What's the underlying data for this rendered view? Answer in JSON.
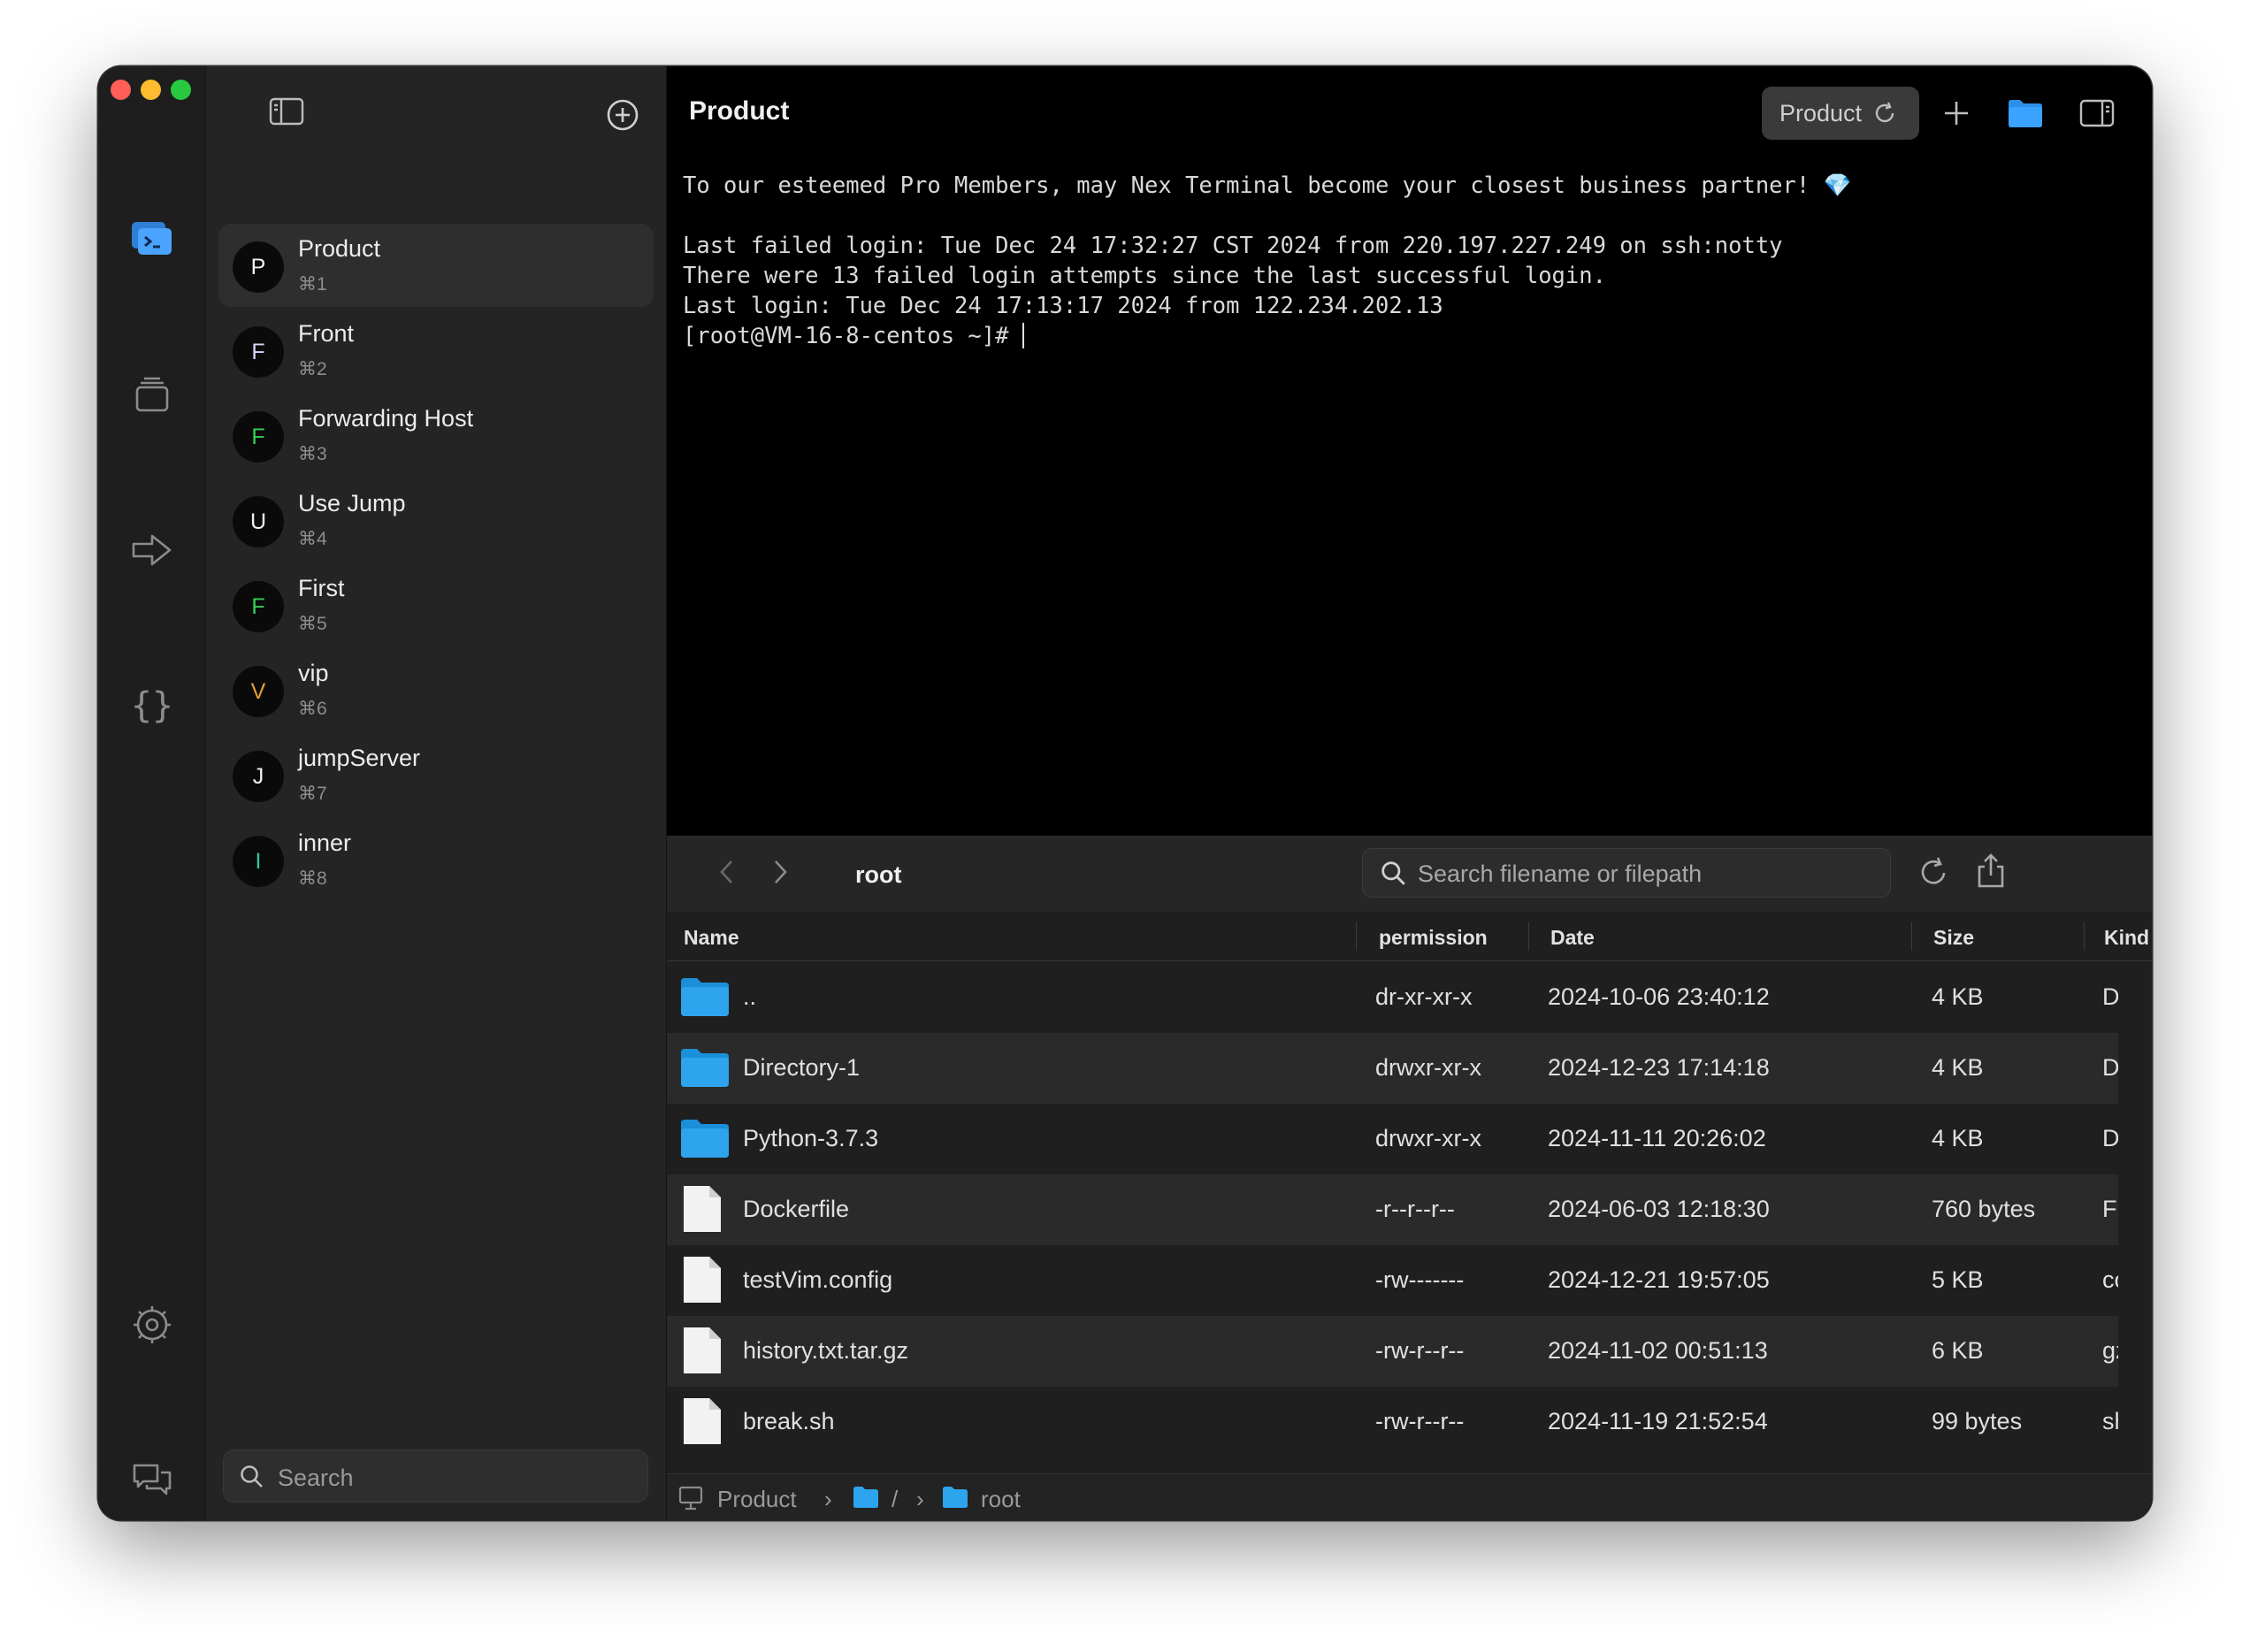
{
  "sidebar": {
    "hosts": [
      {
        "initial": "P",
        "name": "Product",
        "shortcut": "⌘1",
        "color": "#f0f0f0",
        "active": true
      },
      {
        "initial": "F",
        "name": "Front",
        "shortcut": "⌘2",
        "color": "#d6d6ff"
      },
      {
        "initial": "F",
        "name": "Forwarding Host",
        "shortcut": "⌘3",
        "color": "#34d058"
      },
      {
        "initial": "U",
        "name": "Use Jump",
        "shortcut": "⌘4",
        "color": "#f0f0f0"
      },
      {
        "initial": "F",
        "name": "First",
        "shortcut": "⌘5",
        "color": "#34d058"
      },
      {
        "initial": "V",
        "name": "vip",
        "shortcut": "⌘6",
        "color": "#e0a030"
      },
      {
        "initial": "J",
        "name": "jumpServer",
        "shortcut": "⌘7",
        "color": "#f0f0f0"
      },
      {
        "initial": "I",
        "name": "inner",
        "shortcut": "⌘8",
        "color": "#2ec8a0"
      }
    ],
    "search_placeholder": "Search"
  },
  "header": {
    "title": "Product",
    "session_chip": "Product"
  },
  "terminal": {
    "lines": [
      "To our esteemed Pro Members, may Nex Terminal become your closest business partner! 💎",
      "",
      "Last failed login: Tue Dec 24 17:32:27 CST 2024 from 220.197.227.249 on ssh:notty",
      "There were 13 failed login attempts since the last successful login.",
      "Last login: Tue Dec 24 17:13:17 2024 from 122.234.202.13",
      "[root@VM-16-8-centos ~]# "
    ]
  },
  "file_manager": {
    "path": "root",
    "search_placeholder": "Search filename or filepath",
    "columns": [
      "Name",
      "permission",
      "Date",
      "Size",
      "Kind"
    ],
    "files": [
      {
        "type": "folder",
        "name": "..",
        "permission": "dr-xr-xr-x",
        "date": "2024-10-06 23:40:12",
        "size": "4 KB",
        "kind": "Directory"
      },
      {
        "type": "folder",
        "name": "Directory-1",
        "permission": "drwxr-xr-x",
        "date": "2024-12-23 17:14:18",
        "size": "4 KB",
        "kind": "Directory"
      },
      {
        "type": "folder",
        "name": "Python-3.7.3",
        "permission": "drwxr-xr-x",
        "date": "2024-11-11 20:26:02",
        "size": "4 KB",
        "kind": "Directory"
      },
      {
        "type": "file",
        "name": "Dockerfile",
        "permission": "-r--r--r--",
        "date": "2024-06-03 12:18:30",
        "size": "760 bytes",
        "kind": "File"
      },
      {
        "type": "file",
        "name": "testVim.config",
        "permission": "-rw-------",
        "date": "2024-12-21 19:57:05",
        "size": "5 KB",
        "kind": "config"
      },
      {
        "type": "file",
        "name": "history.txt.tar.gz",
        "permission": "-rw-r--r--",
        "date": "2024-11-02 00:51:13",
        "size": "6 KB",
        "kind": "gz"
      },
      {
        "type": "file",
        "name": "break.sh",
        "permission": "-rw-r--r--",
        "date": "2024-11-19 21:52:54",
        "size": "99 bytes",
        "kind": "sh"
      }
    ],
    "status": {
      "host": "Product",
      "root_seg": "/",
      "dir_seg": "root"
    }
  },
  "colors": {
    "accent": "#3a8ee6",
    "folder": "#2ea4ee"
  }
}
